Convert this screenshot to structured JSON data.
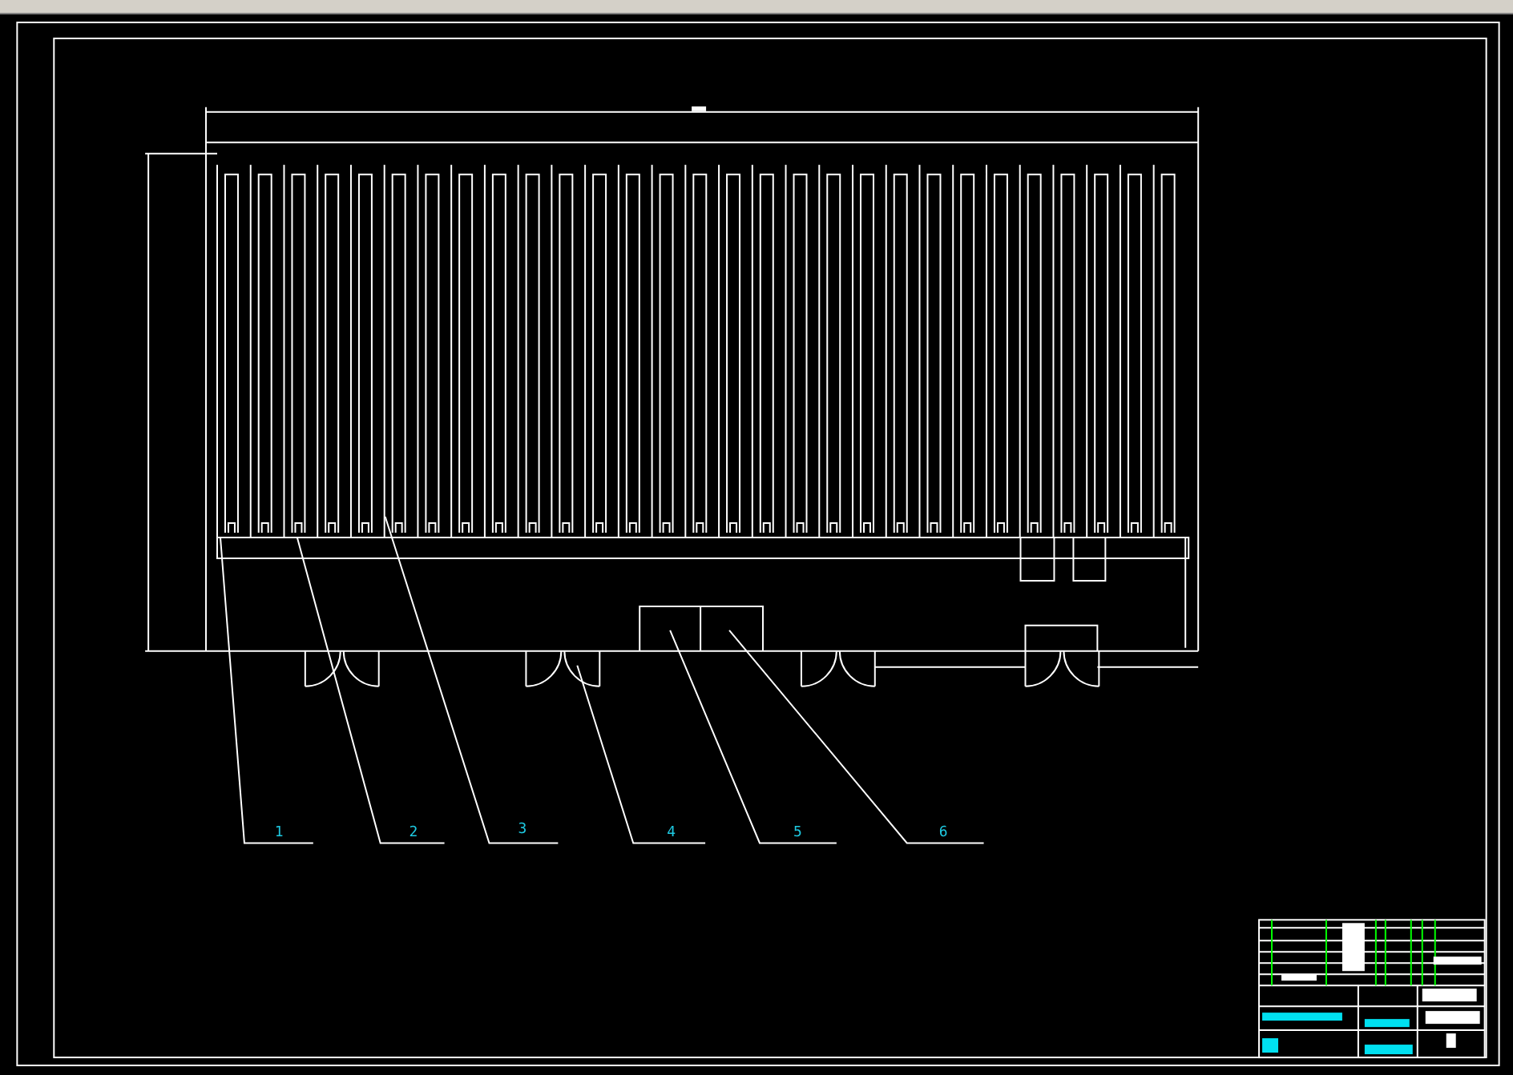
{
  "drawing": {
    "callouts": [
      {
        "label": "1"
      },
      {
        "label": "2"
      },
      {
        "label": "3"
      },
      {
        "label": "4"
      },
      {
        "label": "5"
      },
      {
        "label": "6"
      }
    ]
  }
}
